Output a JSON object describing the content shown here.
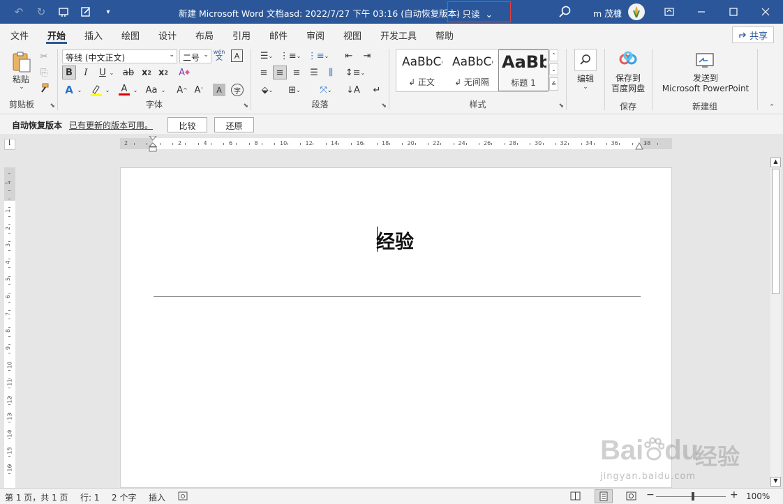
{
  "titlebar": {
    "title": "新建 Microsoft Word 文档asd: 2022/7/27 下午 03:16 (自动恢复版本)",
    "readonly_label": "- 只读",
    "user_name": "m 茂槺"
  },
  "tabs": [
    "文件",
    "开始",
    "插入",
    "绘图",
    "设计",
    "布局",
    "引用",
    "邮件",
    "审阅",
    "视图",
    "开发工具",
    "帮助"
  ],
  "share_label": "共享",
  "ribbon": {
    "clipboard": {
      "paste": "粘贴",
      "label": "剪贴板"
    },
    "font": {
      "name": "等线 (中文正文)",
      "size": "二号",
      "label": "字体",
      "phonetic_top": "wén",
      "phonetic_bottom": "文"
    },
    "paragraph": {
      "label": "段落"
    },
    "styles": {
      "label": "样式",
      "items": [
        {
          "sample": "AaBbCcI",
          "name": "↲ 正文"
        },
        {
          "sample": "AaBbCcI",
          "name": "↲ 无间隔"
        },
        {
          "sample": "AaBb",
          "name": "标题 1"
        }
      ]
    },
    "editing": {
      "label": "编辑"
    },
    "save": {
      "line1": "保存到",
      "line2": "百度网盘",
      "label": "保存"
    },
    "newgroup": {
      "line1": "发送到",
      "line2": "Microsoft PowerPoint",
      "label": "新建组"
    }
  },
  "infobar": {
    "title": "自动恢复版本",
    "message": "已有更新的版本可用。",
    "compare": "比较",
    "restore": "还原"
  },
  "ruler": {
    "h_labels": [
      "2",
      "2",
      "4",
      "6",
      "8",
      "10",
      "12",
      "14",
      "16",
      "18",
      "20",
      "22",
      "24",
      "26",
      "28",
      "30",
      "32",
      "34",
      "36",
      "38"
    ],
    "v_labels": [
      "1",
      "1",
      "2",
      "3",
      "4",
      "5",
      "6",
      "7",
      "8",
      "9",
      "10",
      "11",
      "12",
      "13",
      "14",
      "15",
      "16"
    ]
  },
  "document": {
    "heading": "经验"
  },
  "statusbar": {
    "page": "第 1 页，共 1 页",
    "line": "行: 1",
    "chars": "2 个字",
    "mode": "插入",
    "zoom": "100%"
  },
  "watermark": {
    "brand": "Bai",
    "brand2": "du",
    "cn": "经验",
    "url": "jingyan.baidu.com"
  }
}
